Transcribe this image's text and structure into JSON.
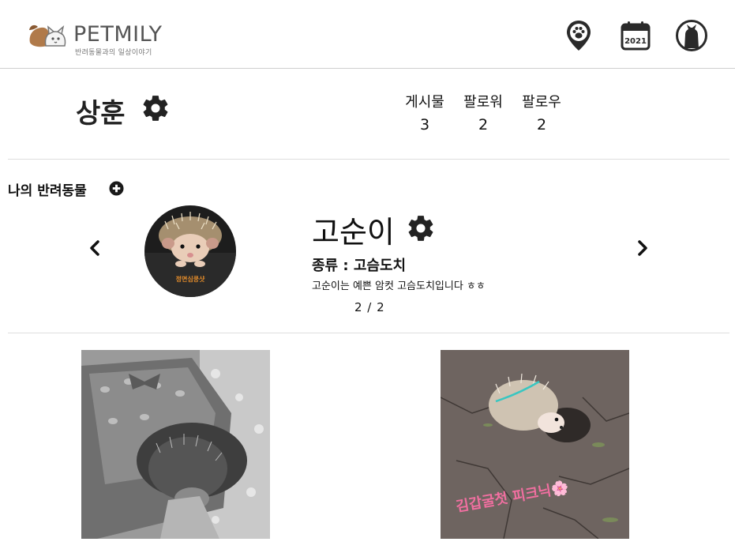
{
  "header": {
    "logo_text": "PETMILY",
    "logo_tagline": "반려동물과의 일상이야기",
    "calendar_year": "2021"
  },
  "profile": {
    "username": "상훈",
    "stats": [
      {
        "label": "게시물",
        "value": "3"
      },
      {
        "label": "팔로워",
        "value": "2"
      },
      {
        "label": "팔로우",
        "value": "2"
      }
    ]
  },
  "pets": {
    "section_title": "나의 반려동물",
    "current": {
      "name": "고순이",
      "species": "종류 : 고슴도치",
      "description": "고순이는 예쁜 암컷 고슴도치입니다 ㅎㅎ",
      "avatar_caption": "정면심쿵샷"
    },
    "pager": "2 / 2"
  },
  "posts": [
    {
      "caption": ""
    },
    {
      "caption": "김갑굴첫 피크닉🌸"
    }
  ],
  "colors": {
    "text": "#111111",
    "logo_brown": "#b07a4a",
    "divider": "#dedede",
    "pink_caption": "#f06fa0"
  },
  "icons": [
    "location-paw-icon",
    "calendar-icon",
    "cat-avatar-icon",
    "gear-icon",
    "plus-circle-icon",
    "chevron-left-icon",
    "chevron-right-icon"
  ]
}
